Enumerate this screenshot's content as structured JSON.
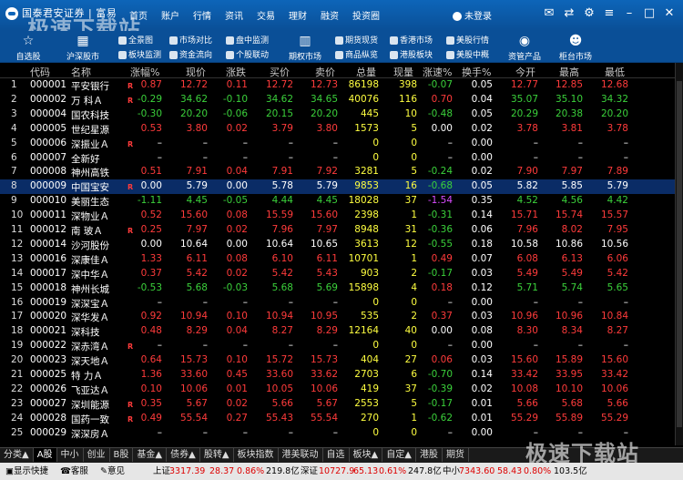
{
  "app": {
    "title": "国泰君安证券 | 富易",
    "menu": [
      "首页",
      "账户",
      "行情",
      "资讯",
      "交易",
      "理财",
      "融资",
      "投资圈"
    ],
    "user_label": "未登录",
    "watermark": "极速下载站"
  },
  "toolbar": {
    "big": [
      {
        "label": "自选股",
        "icon": "star-icon"
      },
      {
        "label": "沪深股市",
        "icon": "chart-icon"
      },
      {
        "label": "期权市场",
        "icon": "option-icon"
      },
      {
        "label": "资管产品",
        "icon": "eye-icon"
      },
      {
        "label": "柜台市场",
        "icon": "person-icon"
      }
    ],
    "small": [
      "全景图",
      "板块监测",
      "市场对比",
      "资金流向",
      "盘中监测",
      "个股联动",
      "期货现货",
      "商品纵览",
      "香港市场",
      "港股板块",
      "美股行情",
      "美股中概"
    ]
  },
  "columns": [
    "代码",
    "名称",
    "涨幅%",
    "现价",
    "涨跌",
    "买价",
    "卖价",
    "总量",
    "现量",
    "涨速%",
    "换手%",
    "今开",
    "最高",
    "最低"
  ],
  "rows": [
    {
      "idx": "1",
      "code": "000001",
      "name": "平安银行",
      "flag": "R",
      "chg_pct": "0.87",
      "price": "12.72",
      "chg": "0.11",
      "bid": "12.72",
      "ask": "12.73",
      "vol": "86198",
      "cur": "398",
      "speed": "-0.07",
      "turn": "0.05",
      "open": "12.77",
      "high": "12.85",
      "low": "12.68"
    },
    {
      "idx": "2",
      "code": "000002",
      "name": "万 科Ａ",
      "flag": "R",
      "chg_pct": "-0.29",
      "price": "34.62",
      "chg": "-0.10",
      "bid": "34.62",
      "ask": "34.65",
      "vol": "40076",
      "cur": "116",
      "speed": "0.70",
      "turn": "0.04",
      "open": "35.07",
      "high": "35.10",
      "low": "34.32"
    },
    {
      "idx": "3",
      "code": "000004",
      "name": "国农科技",
      "flag": "",
      "chg_pct": "-0.30",
      "price": "20.20",
      "chg": "-0.06",
      "bid": "20.15",
      "ask": "20.20",
      "vol": "445",
      "cur": "10",
      "speed": "-0.48",
      "turn": "0.05",
      "open": "20.29",
      "high": "20.38",
      "low": "20.20"
    },
    {
      "idx": "4",
      "code": "000005",
      "name": "世纪星源",
      "flag": "",
      "chg_pct": "0.53",
      "price": "3.80",
      "chg": "0.02",
      "bid": "3.79",
      "ask": "3.80",
      "vol": "1573",
      "cur": "5",
      "speed": "0.00",
      "turn": "0.02",
      "open": "3.78",
      "high": "3.81",
      "low": "3.78"
    },
    {
      "idx": "5",
      "code": "000006",
      "name": "深振业Ａ",
      "flag": "R",
      "chg_pct": "–",
      "price": "–",
      "chg": "–",
      "bid": "–",
      "ask": "–",
      "vol": "0",
      "cur": "0",
      "speed": "–",
      "turn": "0.00",
      "open": "–",
      "high": "–",
      "low": "–"
    },
    {
      "idx": "6",
      "code": "000007",
      "name": "全新好",
      "flag": "",
      "chg_pct": "–",
      "price": "–",
      "chg": "–",
      "bid": "–",
      "ask": "–",
      "vol": "0",
      "cur": "0",
      "speed": "–",
      "turn": "0.00",
      "open": "–",
      "high": "–",
      "low": "–"
    },
    {
      "idx": "7",
      "code": "000008",
      "name": "神州高铁",
      "flag": "",
      "chg_pct": "0.51",
      "price": "7.91",
      "chg": "0.04",
      "bid": "7.91",
      "ask": "7.92",
      "vol": "3281",
      "cur": "5",
      "speed": "-0.24",
      "turn": "0.02",
      "open": "7.90",
      "high": "7.97",
      "low": "7.89"
    },
    {
      "idx": "8",
      "code": "000009",
      "name": "中国宝安",
      "flag": "R",
      "chg_pct": "0.00",
      "price": "5.79",
      "chg": "0.00",
      "bid": "5.78",
      "ask": "5.79",
      "vol": "9853",
      "cur": "16",
      "speed": "-0.68",
      "turn": "0.05",
      "open": "5.82",
      "high": "5.85",
      "low": "5.79"
    },
    {
      "idx": "9",
      "code": "000010",
      "name": "美丽生态",
      "flag": "",
      "chg_pct": "-1.11",
      "price": "4.45",
      "chg": "-0.05",
      "bid": "4.44",
      "ask": "4.45",
      "vol": "18028",
      "cur": "37",
      "speed": "-1.54",
      "turn": "0.35",
      "open": "4.52",
      "high": "4.56",
      "low": "4.42"
    },
    {
      "idx": "10",
      "code": "000011",
      "name": "深物业Ａ",
      "flag": "",
      "chg_pct": "0.52",
      "price": "15.60",
      "chg": "0.08",
      "bid": "15.59",
      "ask": "15.60",
      "vol": "2398",
      "cur": "1",
      "speed": "-0.31",
      "turn": "0.14",
      "open": "15.71",
      "high": "15.74",
      "low": "15.57"
    },
    {
      "idx": "11",
      "code": "000012",
      "name": "南 玻Ａ",
      "flag": "R",
      "chg_pct": "0.25",
      "price": "7.97",
      "chg": "0.02",
      "bid": "7.96",
      "ask": "7.97",
      "vol": "8948",
      "cur": "31",
      "speed": "-0.36",
      "turn": "0.06",
      "open": "7.96",
      "high": "8.02",
      "low": "7.95"
    },
    {
      "idx": "12",
      "code": "000014",
      "name": "沙河股份",
      "flag": "",
      "chg_pct": "0.00",
      "price": "10.64",
      "chg": "0.00",
      "bid": "10.64",
      "ask": "10.65",
      "vol": "3613",
      "cur": "12",
      "speed": "-0.55",
      "turn": "0.18",
      "open": "10.58",
      "high": "10.86",
      "low": "10.56"
    },
    {
      "idx": "13",
      "code": "000016",
      "name": "深康佳Ａ",
      "flag": "",
      "chg_pct": "1.33",
      "price": "6.11",
      "chg": "0.08",
      "bid": "6.10",
      "ask": "6.11",
      "vol": "10701",
      "cur": "1",
      "speed": "0.49",
      "turn": "0.07",
      "open": "6.08",
      "high": "6.13",
      "low": "6.06"
    },
    {
      "idx": "14",
      "code": "000017",
      "name": "深中华Ａ",
      "flag": "",
      "chg_pct": "0.37",
      "price": "5.42",
      "chg": "0.02",
      "bid": "5.42",
      "ask": "5.43",
      "vol": "903",
      "cur": "2",
      "speed": "-0.17",
      "turn": "0.03",
      "open": "5.49",
      "high": "5.49",
      "low": "5.42"
    },
    {
      "idx": "15",
      "code": "000018",
      "name": "神州长城",
      "flag": "",
      "chg_pct": "-0.53",
      "price": "5.68",
      "chg": "-0.03",
      "bid": "5.68",
      "ask": "5.69",
      "vol": "15898",
      "cur": "4",
      "speed": "0.18",
      "turn": "0.12",
      "open": "5.71",
      "high": "5.74",
      "low": "5.65"
    },
    {
      "idx": "16",
      "code": "000019",
      "name": "深深宝Ａ",
      "flag": "",
      "chg_pct": "–",
      "price": "–",
      "chg": "–",
      "bid": "–",
      "ask": "–",
      "vol": "0",
      "cur": "0",
      "speed": "–",
      "turn": "0.00",
      "open": "–",
      "high": "–",
      "low": "–"
    },
    {
      "idx": "17",
      "code": "000020",
      "name": "深华发Ａ",
      "flag": "",
      "chg_pct": "0.92",
      "price": "10.94",
      "chg": "0.10",
      "bid": "10.94",
      "ask": "10.95",
      "vol": "535",
      "cur": "2",
      "speed": "0.37",
      "turn": "0.03",
      "open": "10.96",
      "high": "10.96",
      "low": "10.84"
    },
    {
      "idx": "18",
      "code": "000021",
      "name": "深科技",
      "flag": "",
      "chg_pct": "0.48",
      "price": "8.29",
      "chg": "0.04",
      "bid": "8.27",
      "ask": "8.29",
      "vol": "12164",
      "cur": "40",
      "speed": "0.00",
      "turn": "0.08",
      "open": "8.30",
      "high": "8.34",
      "low": "8.27"
    },
    {
      "idx": "19",
      "code": "000022",
      "name": "深赤湾Ａ",
      "flag": "R",
      "chg_pct": "–",
      "price": "–",
      "chg": "–",
      "bid": "–",
      "ask": "–",
      "vol": "0",
      "cur": "0",
      "speed": "–",
      "turn": "0.00",
      "open": "–",
      "high": "–",
      "low": "–"
    },
    {
      "idx": "20",
      "code": "000023",
      "name": "深天地Ａ",
      "flag": "",
      "chg_pct": "0.64",
      "price": "15.73",
      "chg": "0.10",
      "bid": "15.72",
      "ask": "15.73",
      "vol": "404",
      "cur": "27",
      "speed": "0.06",
      "turn": "0.03",
      "open": "15.60",
      "high": "15.89",
      "low": "15.60"
    },
    {
      "idx": "21",
      "code": "000025",
      "name": "特 力Ａ",
      "flag": "",
      "chg_pct": "1.36",
      "price": "33.60",
      "chg": "0.45",
      "bid": "33.60",
      "ask": "33.62",
      "vol": "2703",
      "cur": "6",
      "speed": "-0.70",
      "turn": "0.14",
      "open": "33.42",
      "high": "33.95",
      "low": "33.42"
    },
    {
      "idx": "22",
      "code": "000026",
      "name": "飞亚达Ａ",
      "flag": "",
      "chg_pct": "0.10",
      "price": "10.06",
      "chg": "0.01",
      "bid": "10.05",
      "ask": "10.06",
      "vol": "419",
      "cur": "37",
      "speed": "-0.39",
      "turn": "0.02",
      "open": "10.08",
      "high": "10.10",
      "low": "10.06"
    },
    {
      "idx": "23",
      "code": "000027",
      "name": "深圳能源",
      "flag": "R",
      "chg_pct": "0.35",
      "price": "5.67",
      "chg": "0.02",
      "bid": "5.66",
      "ask": "5.67",
      "vol": "2553",
      "cur": "5",
      "speed": "-0.17",
      "turn": "0.01",
      "open": "5.66",
      "high": "5.68",
      "low": "5.66"
    },
    {
      "idx": "24",
      "code": "000028",
      "name": "国药一致",
      "flag": "R",
      "chg_pct": "0.49",
      "price": "55.54",
      "chg": "0.27",
      "bid": "55.43",
      "ask": "55.54",
      "vol": "270",
      "cur": "1",
      "speed": "-0.62",
      "turn": "0.01",
      "open": "55.29",
      "high": "55.89",
      "low": "55.29"
    },
    {
      "idx": "25",
      "code": "000029",
      "name": "深深房Ａ",
      "flag": "",
      "chg_pct": "–",
      "price": "–",
      "chg": "–",
      "bid": "–",
      "ask": "–",
      "vol": "0",
      "cur": "0",
      "speed": "–",
      "turn": "0.00",
      "open": "–",
      "high": "–",
      "low": "–"
    }
  ],
  "tabs": [
    "分类▲",
    "A股",
    "中小",
    "创业",
    "B股",
    "基金▲",
    "债券▲",
    "股转▲",
    "板块指数",
    "港美联动",
    "自选",
    "板块▲",
    "自定▲",
    "港股",
    "期货"
  ],
  "status": {
    "quick": "显示快捷",
    "service": "客服",
    "feedback": "意见",
    "sh_label": "上证",
    "sh_val": "3317.39",
    "sh_chg": "28.37",
    "sh_pct": "0.86%",
    "sh_amt": "219.8亿",
    "sz_label": "深证",
    "sz_val": "10727.9",
    "sz_chg": "65.13",
    "sz_pct": "0.61%",
    "sz_amt": "247.8亿",
    "zx_label": "中小",
    "zx_val": "7343.60",
    "zx_chg": "58.43",
    "zx_pct": "0.80%",
    "zx_amt": "103.5亿"
  },
  "colors": {
    "up": "#ff3b3b",
    "down": "#3bd13b",
    "flat": "#ffffff",
    "code": "#ffffff",
    "name": "#ffffff",
    "vol": "#ffff40",
    "cur": "#ffff40",
    "turn": "#ffffff",
    "speed_hi": "#d94cff",
    "flag": "#ff3b3b"
  }
}
